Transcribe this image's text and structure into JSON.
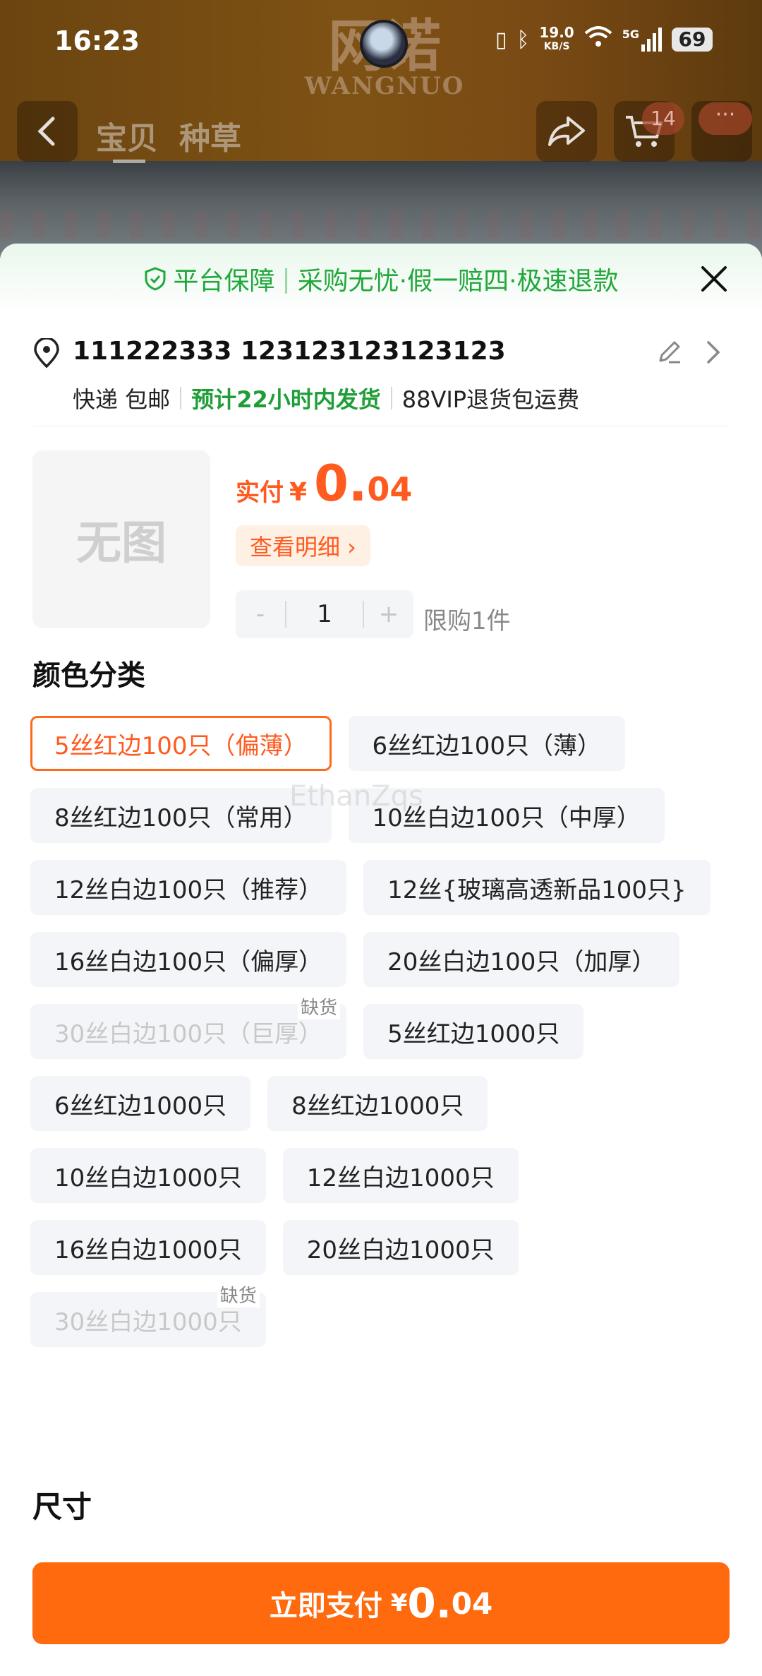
{
  "status_bar": {
    "time": "16:23",
    "net_speed_value": "19.0",
    "net_speed_unit": "KB/S",
    "signal_label": "5G",
    "battery": "69"
  },
  "brand": {
    "cn": "网诺",
    "en": "WANGNUO"
  },
  "nav": {
    "tabs": [
      "宝贝",
      "种草"
    ],
    "cart_count": "14",
    "more_label": "···"
  },
  "guarantee": {
    "parts": [
      "平台保障",
      "采购无忧·假一赔四·极速退款"
    ]
  },
  "address": {
    "line1": "111222333 123123123123123",
    "shipping": "快递 包邮",
    "ship_time": "预计22小时内发货",
    "return_note": "88VIP退货包运费"
  },
  "product": {
    "no_image": "无图",
    "price_label": "实付",
    "currency": "¥",
    "price_int": "0.",
    "price_dec": "04",
    "detail_button": "查看明细 ›",
    "qty_minus": "-",
    "qty": "1",
    "qty_plus": "+",
    "limit": "限购1件"
  },
  "color_section": {
    "title": "颜色分类",
    "options": [
      {
        "label": "5丝红边100只（偏薄）",
        "state": "selected"
      },
      {
        "label": "6丝红边100只（薄）",
        "state": "normal"
      },
      {
        "label": "8丝红边100只（常用）",
        "state": "normal"
      },
      {
        "label": "10丝白边100只（中厚）",
        "state": "normal"
      },
      {
        "label": "12丝白边100只（推荐）",
        "state": "normal"
      },
      {
        "label": "12丝{玻璃高透新品100只}",
        "state": "normal"
      },
      {
        "label": "16丝白边100只（偏厚）",
        "state": "normal"
      },
      {
        "label": "20丝白边100只（加厚）",
        "state": "normal"
      },
      {
        "label": "30丝白边100只（巨厚）",
        "state": "disabled",
        "tag": "缺货"
      },
      {
        "label": "5丝红边1000只",
        "state": "normal"
      },
      {
        "label": "6丝红边1000只",
        "state": "normal"
      },
      {
        "label": "8丝红边1000只",
        "state": "normal"
      },
      {
        "label": "10丝白边1000只",
        "state": "normal"
      },
      {
        "label": "12丝白边1000只",
        "state": "normal"
      },
      {
        "label": "16丝白边1000只",
        "state": "normal"
      },
      {
        "label": "20丝白边1000只",
        "state": "normal"
      },
      {
        "label": "30丝白边1000只",
        "state": "disabled",
        "tag": "缺货"
      }
    ]
  },
  "watermark": "EthanZqs",
  "size_section": {
    "title": "尺寸"
  },
  "pay": {
    "label": "立即支付",
    "currency": "¥",
    "int": "0.",
    "dec": "04"
  },
  "colors": {
    "accent": "#ff6a0e",
    "green": "#21a83b"
  }
}
